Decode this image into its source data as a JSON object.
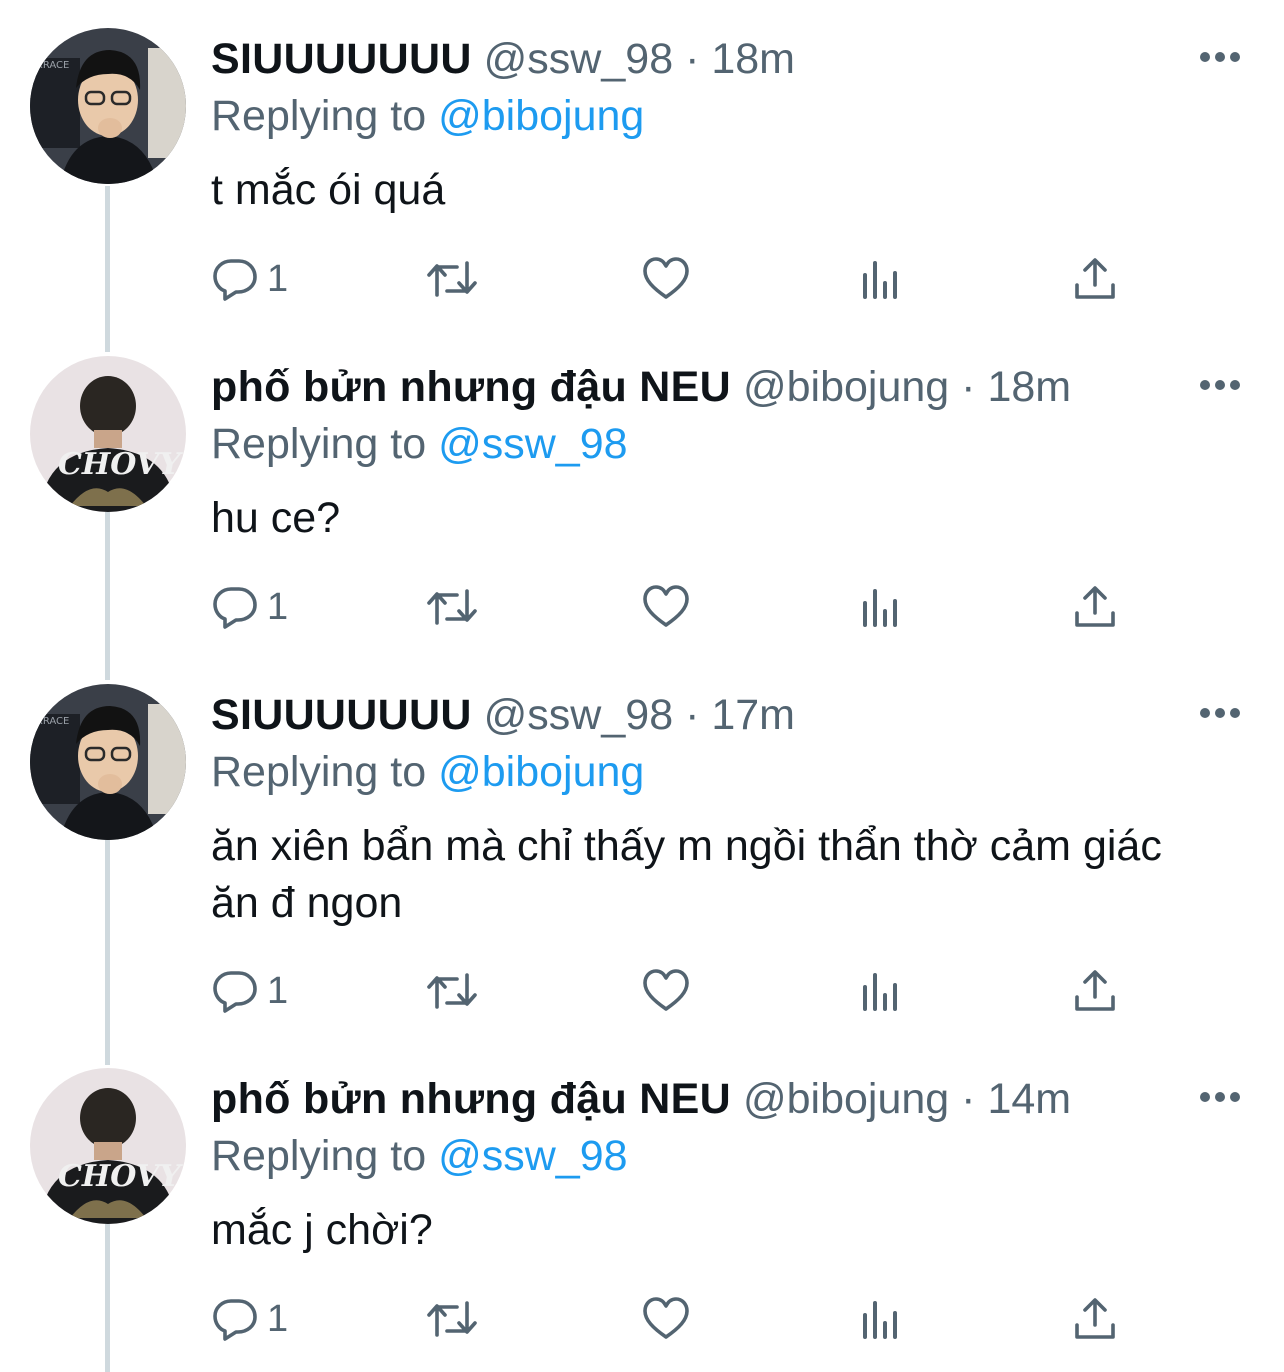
{
  "colors": {
    "text": "#0f1419",
    "secondary": "#536471",
    "accent": "#1d9bf0",
    "thread_line": "#cfd9de"
  },
  "icons": {
    "reply": "reply-icon",
    "retweet": "retweet-icon",
    "like": "heart-icon",
    "views": "analytics-icon",
    "share": "share-icon",
    "more": "more-icon"
  },
  "tweets": [
    {
      "display_name": "SIUUUUUUU",
      "handle": "@ssw_98",
      "separator": "·",
      "time": "18m",
      "replying_prefix": "Replying to",
      "replying_to": "@bibojung",
      "text": "t mắc ói quá",
      "reply_count": "1",
      "avatar": "avatar-ssw-98"
    },
    {
      "display_name": "phố bửn nhưng đậu NEU",
      "handle": "@bibojung",
      "separator": "·",
      "time": "18m",
      "replying_prefix": "Replying to",
      "replying_to": "@ssw_98",
      "text": "hu ce?",
      "reply_count": "1",
      "avatar": "avatar-bibojung"
    },
    {
      "display_name": "SIUUUUUUU",
      "handle": "@ssw_98",
      "separator": "·",
      "time": "17m",
      "replying_prefix": "Replying to",
      "replying_to": "@bibojung",
      "text": "ăn xiên bẩn mà chỉ thấy m ngồi thẩn thờ cảm giác ăn đ ngon",
      "reply_count": "1",
      "avatar": "avatar-ssw-98"
    },
    {
      "display_name": "phố bửn nhưng đậu NEU",
      "handle": "@bibojung",
      "separator": "·",
      "time": "14m",
      "replying_prefix": "Replying to",
      "replying_to": "@ssw_98",
      "text": "mắc j chời?",
      "reply_count": "1",
      "avatar": "avatar-bibojung"
    }
  ]
}
